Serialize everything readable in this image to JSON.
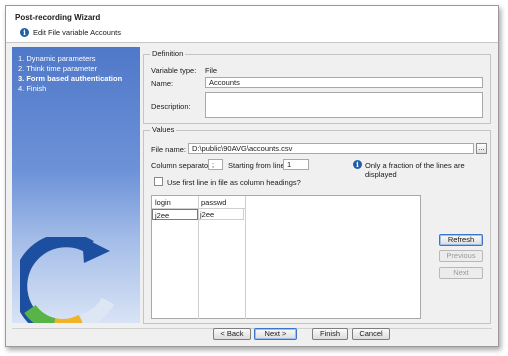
{
  "window": {
    "title": "Post-recording Wizard",
    "subtitle": "Edit File variable Accounts"
  },
  "steps": [
    {
      "label": "1. Dynamic parameters",
      "active": false
    },
    {
      "label": "2. Think time parameter",
      "active": false
    },
    {
      "label": "3. Form based authentication",
      "active": true
    },
    {
      "label": "4. Finish",
      "active": false
    }
  ],
  "definition": {
    "legend": "Definition",
    "variable_type_label": "Variable type:",
    "variable_type_value": "File",
    "name_label": "Name:",
    "name_value": "Accounts",
    "description_label": "Description:",
    "description_value": ""
  },
  "values": {
    "legend": "Values",
    "file_name_label": "File name:",
    "file_name_value": "D:\\public\\90AVG\\accounts.csv",
    "browse_label": "...",
    "column_separator_label": "Column separator:",
    "column_separator_value": ";",
    "starting_line_label": "Starting from line:",
    "starting_line_value": "1",
    "fraction_note": "Only a fraction of the lines are displayed",
    "use_first_line_label": "Use first line in file as column headings?",
    "use_first_line_checked": false,
    "columns": [
      "login",
      "passwd"
    ],
    "rows": [
      [
        "j2ee",
        "j2ee"
      ]
    ]
  },
  "side_buttons": {
    "refresh": "Refresh",
    "previous": "Previous",
    "next": "Next"
  },
  "footer": {
    "back": "< Back",
    "next": "Next >",
    "finish": "Finish",
    "cancel": "Cancel"
  },
  "colors": {
    "accent": "#1f5fa8",
    "panel_top": "#4f78c8"
  }
}
